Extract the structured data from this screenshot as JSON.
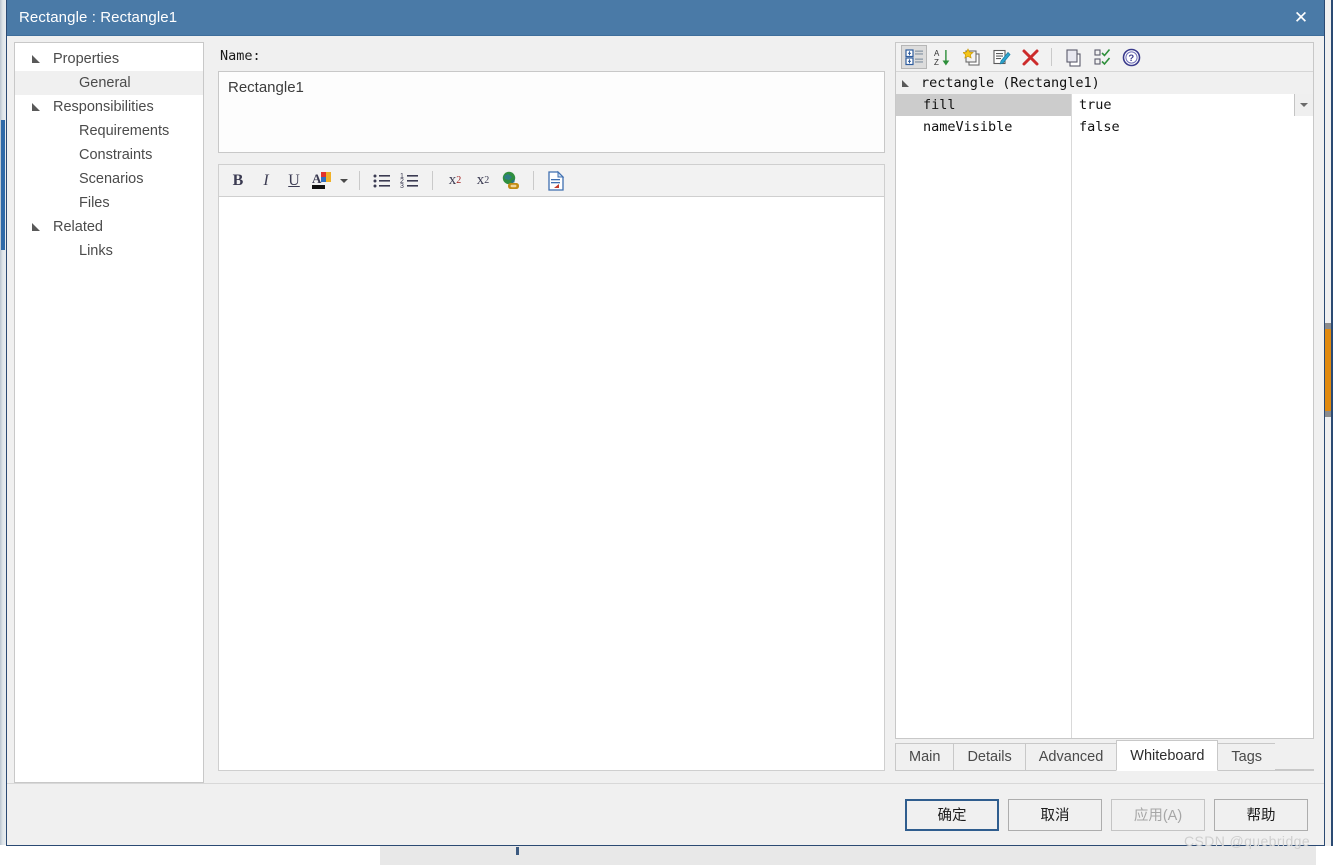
{
  "window": {
    "title": "Rectangle : Rectangle1",
    "close_label": "✕",
    "titlebar_color": "#4a7aa7"
  },
  "nav": {
    "items": [
      {
        "label": "Properties",
        "level": 0,
        "expandable": true,
        "selected": false
      },
      {
        "label": "General",
        "level": 1,
        "expandable": false,
        "selected": true
      },
      {
        "label": "Responsibilities",
        "level": 0,
        "expandable": true,
        "selected": false
      },
      {
        "label": "Requirements",
        "level": 1,
        "expandable": false,
        "selected": false
      },
      {
        "label": "Constraints",
        "level": 1,
        "expandable": false,
        "selected": false
      },
      {
        "label": "Scenarios",
        "level": 1,
        "expandable": false,
        "selected": false
      },
      {
        "label": "Files",
        "level": 1,
        "expandable": false,
        "selected": false
      },
      {
        "label": "Related",
        "level": 0,
        "expandable": true,
        "selected": false
      },
      {
        "label": "Links",
        "level": 1,
        "expandable": false,
        "selected": false
      }
    ]
  },
  "general": {
    "name_label": "Name:",
    "name_value": "Rectangle1",
    "name_placeholder": "",
    "notes_value": "",
    "notes_placeholder": ""
  },
  "rte_toolbar": {
    "buttons": [
      {
        "name": "bold-icon",
        "glyph": "B",
        "tooltip": "Bold"
      },
      {
        "name": "italic-icon",
        "glyph": "I",
        "tooltip": "Italic"
      },
      {
        "name": "underline-icon",
        "glyph": "U",
        "tooltip": "Underline"
      },
      {
        "name": "font-color-icon",
        "glyph": "A",
        "tooltip": "Font Color"
      },
      {
        "name": "font-color-dropdown-icon",
        "glyph": "▾",
        "tooltip": "More colors"
      },
      {
        "name": "bullet-list-icon",
        "glyph": "",
        "tooltip": "Bulleted List"
      },
      {
        "name": "numbered-list-icon",
        "glyph": "",
        "tooltip": "Numbered List"
      },
      {
        "name": "superscript-icon",
        "glyph": "x",
        "tooltip": "Superscript"
      },
      {
        "name": "subscript-icon",
        "glyph": "x",
        "tooltip": "Subscript"
      },
      {
        "name": "hyperlink-icon",
        "glyph": "",
        "tooltip": "Insert Hyperlink"
      },
      {
        "name": "insert-document-icon",
        "glyph": "",
        "tooltip": "Insert Document"
      }
    ]
  },
  "property_grid": {
    "toolbar": [
      {
        "name": "categorized-view-icon",
        "tooltip": "Categorized",
        "active": true
      },
      {
        "name": "sort-alphabetical-icon",
        "tooltip": "Alphabetical",
        "active": false
      },
      {
        "name": "new-property-icon",
        "tooltip": "New",
        "active": false
      },
      {
        "name": "edit-property-icon",
        "tooltip": "Edit",
        "active": false
      },
      {
        "name": "delete-property-icon",
        "tooltip": "Delete",
        "active": false
      },
      {
        "name": "copy-icon",
        "tooltip": "Copy",
        "active": false
      },
      {
        "name": "select-columns-icon",
        "tooltip": "Select",
        "active": false
      },
      {
        "name": "help-icon",
        "tooltip": "Help",
        "active": false
      }
    ],
    "category": "rectangle (Rectangle1)",
    "rows": [
      {
        "key": "fill",
        "value": "true",
        "selected": true,
        "has_dropdown": true
      },
      {
        "key": "nameVisible",
        "value": "false",
        "selected": false,
        "has_dropdown": false
      }
    ]
  },
  "tabs": {
    "items": [
      {
        "label": "Main",
        "active": false
      },
      {
        "label": "Details",
        "active": false
      },
      {
        "label": "Advanced",
        "active": false
      },
      {
        "label": "Whiteboard",
        "active": true
      },
      {
        "label": "Tags",
        "active": false
      }
    ]
  },
  "footer": {
    "buttons": [
      {
        "label": "确定",
        "style": "default"
      },
      {
        "label": "取消",
        "style": "normal"
      },
      {
        "label": "应用(A)",
        "style": "disabled"
      },
      {
        "label": "帮助",
        "style": "normal"
      }
    ],
    "watermark": "CSDN @quebridge"
  }
}
